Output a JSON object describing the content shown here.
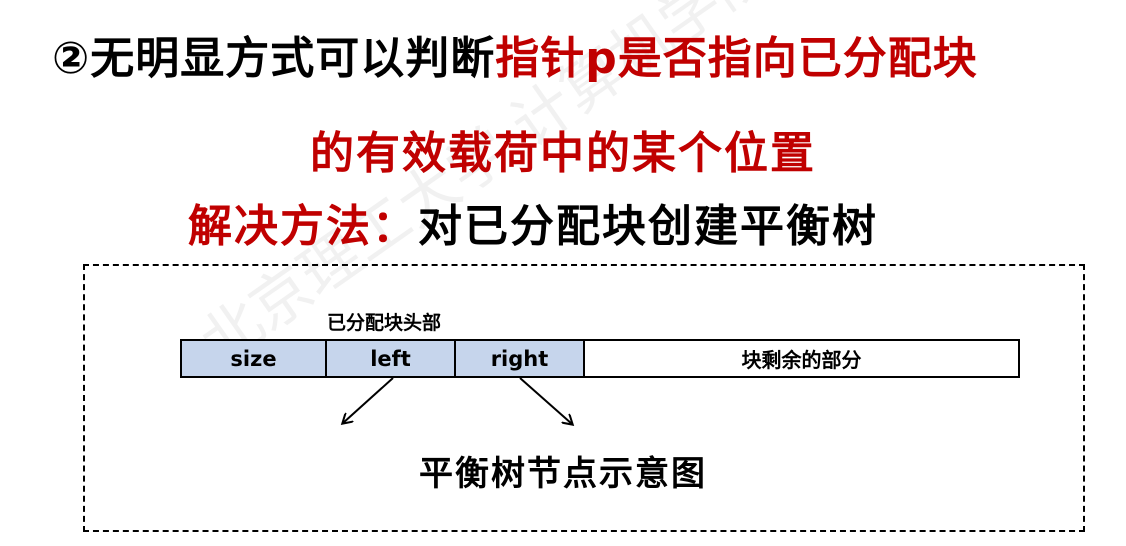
{
  "heading": {
    "line1_black": "②无明显方式可以判断",
    "line1_red": "指针p是否指向已分配块",
    "line2_red": "的有效载荷中的某个位置",
    "line3_red": "解决方法：",
    "line3_black": "对已分配块创建平衡树"
  },
  "diagram": {
    "header_label": "已分配块头部",
    "cells": {
      "size": "size",
      "left": "left",
      "right": "right",
      "rest": "块剩余的部分"
    },
    "caption": "平衡树节点示意图"
  },
  "watermark": "北京理工大学 计算机学院 高人",
  "colors": {
    "accent_red": "#c00000",
    "header_fill": "#c6d5ec"
  }
}
